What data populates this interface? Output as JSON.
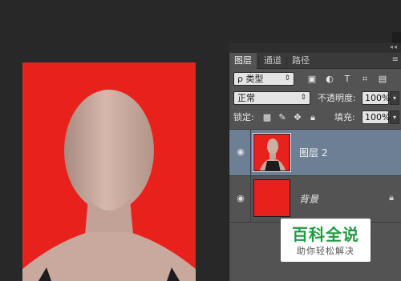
{
  "colors": {
    "canvas_background": "#e8211c",
    "selected_layer": "#6d7f95",
    "panel": "#535353",
    "watermark_text": "#1f9b3f"
  },
  "layers_panel": {
    "tabs": [
      {
        "label": "图层",
        "active": true
      },
      {
        "label": "通道",
        "active": false
      },
      {
        "label": "路径",
        "active": false
      }
    ],
    "filter": {
      "kind_label": "ρ 类型",
      "icons": [
        "image-filter-icon",
        "adjustment-filter-icon",
        "type-filter-icon",
        "shape-filter-icon",
        "smart-object-filter-icon"
      ]
    },
    "blend_mode": "正常",
    "opacity_label": "不透明度:",
    "opacity_value": "100%",
    "lock_label": "锁定:",
    "lock_icons": [
      "lock-transparent-icon",
      "lock-image-icon",
      "lock-position-icon",
      "lock-all-icon"
    ],
    "fill_label": "填充:",
    "fill_value": "100%",
    "layers": [
      {
        "name": "图层 2",
        "visible": true,
        "selected": true,
        "locked": false
      },
      {
        "name": "背景",
        "visible": true,
        "selected": false,
        "locked": true
      }
    ]
  },
  "watermark": {
    "title": "百科全说",
    "subtitle": "助你轻松解决"
  }
}
